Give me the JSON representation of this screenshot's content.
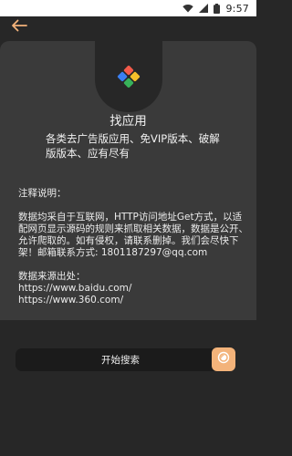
{
  "status_bar": {
    "time": "9:57",
    "icons": [
      "wifi-icon",
      "signal-icon",
      "battery-icon"
    ]
  },
  "header": {
    "back_icon": "back-arrow-icon",
    "accent_color": "#f3b37a"
  },
  "app": {
    "logo_icon": "app-logo-icon",
    "title": "找应用",
    "subtitle": "各类去广告版应用、免VIP版本、破解版版本、应有尽有"
  },
  "notes": {
    "heading": "注释说明：",
    "body": "数据均采自于互联网，HTTP访问地址Get方式，以适配网页显示源码的规则来抓取相关数据，数据是公开、允许爬取的。如有侵权，请联系删掉。我们会尽快下架！邮箱联系方式: 1801187297@qq.com",
    "source_heading": "数据来源出处：",
    "sources": [
      "https://www.baidu.com/",
      "https://www.360.com/"
    ]
  },
  "actions": {
    "search_label": "开始搜索",
    "search_icon": "search-icon"
  }
}
